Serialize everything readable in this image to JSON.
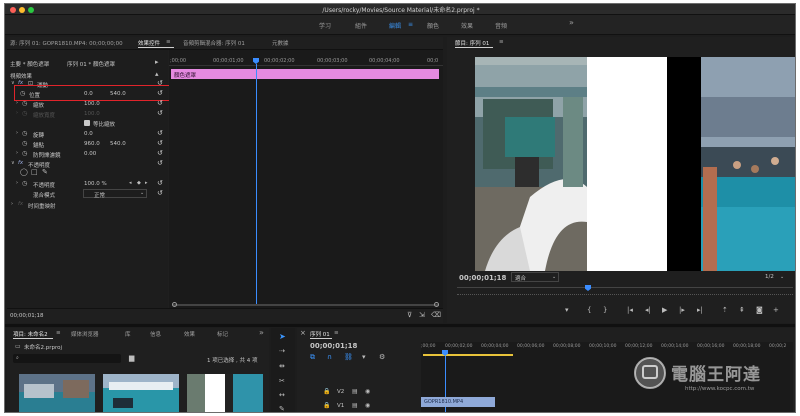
{
  "window": {
    "title": "/Users/rocky/Movies/Source Material/未命名2.prproj *"
  },
  "workspaces": {
    "items": [
      "学习",
      "組件",
      "編輯",
      "顏色",
      "效果",
      "音頻"
    ],
    "active": "編輯",
    "more": "»"
  },
  "effect_panel": {
    "source_tab": "源: 序列 01: GOPR1810.MP4: 00;00;00;00",
    "tab_effect_controls": "效果控件",
    "tab_audio_mixer": "音頻剪輯混合器: 序列 01",
    "tab_metadata": "元數據",
    "clip_path": "主要 * 顏色遮罩",
    "sequence_path": "序列 01 * 顏色遮罩",
    "section_video": "視頻效果",
    "motion_label": "運動",
    "position_label": "位置",
    "position_x": "0.0",
    "position_y": "540.0",
    "scale_label": "縮放",
    "scale_value": "100.0",
    "scale_width_label": "縮放寬度",
    "scale_width_value": "100.0",
    "uniform_scale_label": "等比縮放",
    "rotation_label": "旋轉",
    "rotation_value": "0.0",
    "anchor_label": "錨點",
    "anchor_x": "960.0",
    "anchor_y": "540.0",
    "flicker_label": "防閃爍濾鏡",
    "flicker_value": "0.00",
    "opacity_section_label": "不透明度",
    "opacity_label": "不透明度",
    "opacity_value": "100.0 %",
    "blend_label": "混合模式",
    "blend_value": "正常",
    "time_remap_label": "时间重映射",
    "ruler_labels": [
      ";00;00",
      "00;00;01;00",
      "00;00;02;00",
      "00;00;03;00",
      "00;00;04;00",
      "00;0"
    ],
    "clip_name": "顏色遮罩",
    "bottom_timecode": "00;00;01;18"
  },
  "program_panel": {
    "title": "節目: 序列 01",
    "timecode": "00;00;01;18",
    "fit": "適合",
    "fraction": "1/2"
  },
  "project_panel": {
    "tab_project": "項目: 未命名2",
    "tab_media": "媒体浏览器",
    "tab_library": "库",
    "tab_info": "信息",
    "tab_effects": "效果",
    "tab_markers": "标记",
    "more": "»",
    "file_name": "未命名2.prproj",
    "selection_info": "1 项已选择 , 共 4 项"
  },
  "timeline_panel": {
    "tab": "序列 01",
    "timecode": "00;00;01;18",
    "ruler_labels": [
      ";00;00",
      "00;00;02;00",
      "00;00;04;00",
      "00;00;06;00",
      "00;00;08;00",
      "00;00;10;00",
      "00;00;12;00",
      "00;00;14;00",
      "00;00;16;00",
      "00;00;18;00",
      "00;00;2"
    ],
    "track_v2": "V2",
    "track_v1": "V1",
    "clip_name": "GOPR1810.MP4"
  },
  "watermark": {
    "text": "電腦王阿達",
    "url": "http://www.kocpc.com.tw"
  },
  "colors": {
    "accent": "#3b96ff",
    "clip_pink": "#e58ae0",
    "highlight_red": "#e1242b",
    "playhead": "#3b8dff"
  }
}
